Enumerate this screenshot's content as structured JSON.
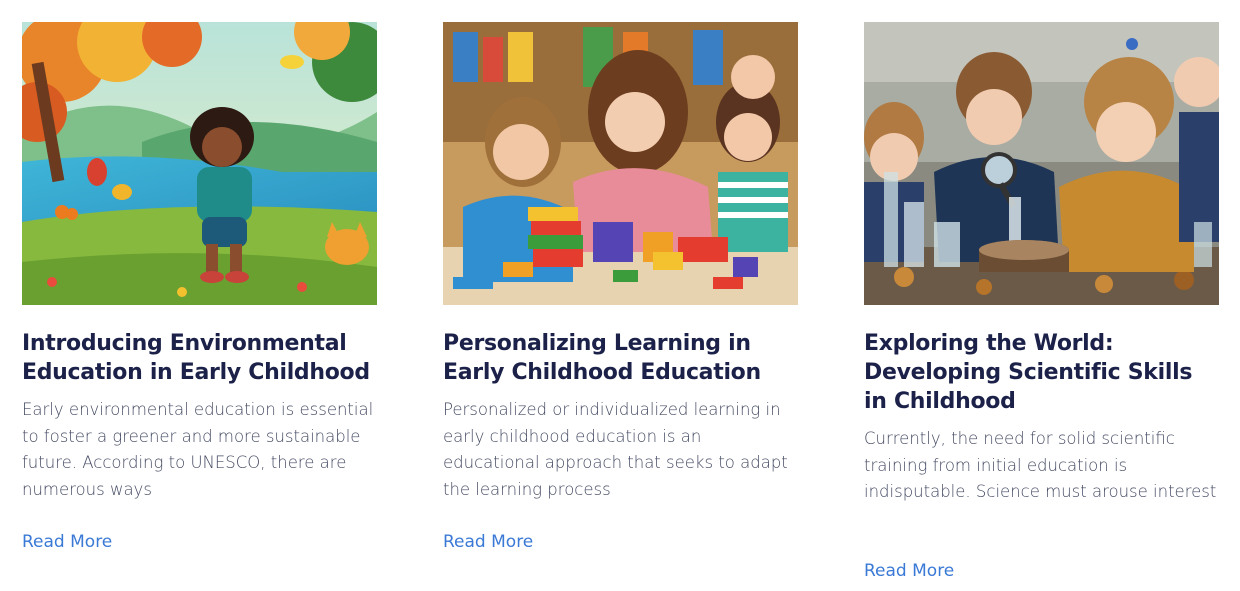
{
  "articles": [
    {
      "title": "Introducing Environmental Education in Early Childhood",
      "excerpt": "Early environmental education is essential to foster a greener and more sustainable future. According to UNESCO, there are numerous ways",
      "read_more": "Read More",
      "image": "child-in-nature-illustration"
    },
    {
      "title": "Personalizing Learning in Early Childhood Education",
      "excerpt": "Personalized or individualized learning in early childhood education is an educational approach that seeks to adapt the learning process",
      "read_more": "Read More",
      "image": "children-playing-with-blocks-photo"
    },
    {
      "title": "Exploring the World: Developing Scientific Skills in Childhood",
      "excerpt": "Currently, the need for solid scientific training from initial education is indisputable. Science must arouse interest",
      "read_more": "Read More",
      "image": "children-with-magnifying-glass-photo"
    }
  ],
  "colors": {
    "title": "#1b2148",
    "excerpt": "#454b63",
    "link": "#3a79d6"
  }
}
